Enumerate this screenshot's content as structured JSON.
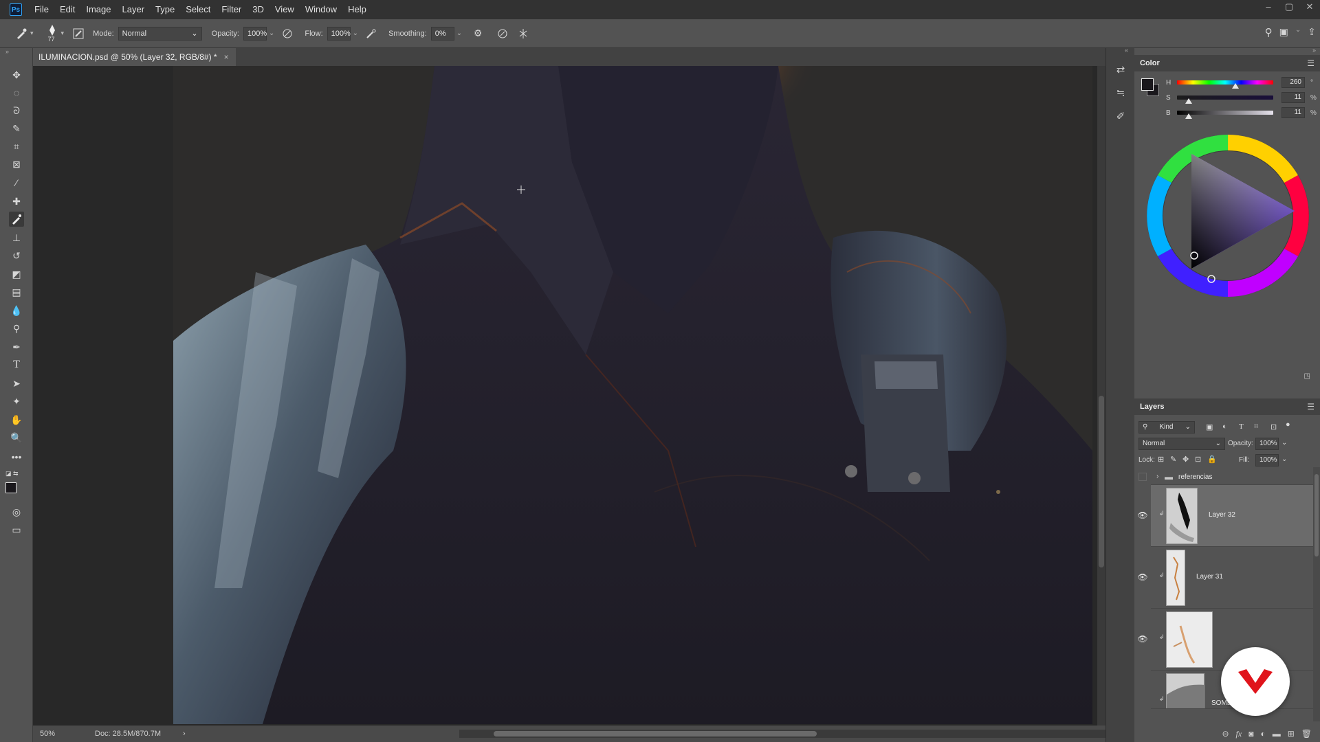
{
  "app": {
    "logo": "Ps"
  },
  "menu": [
    "File",
    "Edit",
    "Image",
    "Layer",
    "Type",
    "Select",
    "Filter",
    "3D",
    "View",
    "Window",
    "Help"
  ],
  "window_controls": [
    "minimize-icon",
    "maximize-icon",
    "close-icon"
  ],
  "options": {
    "brush_size": "77",
    "mode_label": "Mode:",
    "mode_value": "Normal",
    "opacity_label": "Opacity:",
    "opacity_value": "100%",
    "flow_label": "Flow:",
    "flow_value": "100%",
    "smoothing_label": "Smoothing:",
    "smoothing_value": "0%"
  },
  "document": {
    "tab_title": "ILUMINACION.psd @ 50% (Layer 32, RGB/8#) *",
    "close": "×"
  },
  "status": {
    "zoom": "50%",
    "doc_size": "Doc: 28.5M/870.7M",
    "arrow": "›"
  },
  "color_panel": {
    "title": "Color",
    "h_label": "H",
    "h_value": "260",
    "h_unit": "°",
    "s_label": "S",
    "s_value": "11",
    "s_unit": "%",
    "b_label": "B",
    "b_value": "11",
    "b_unit": "%",
    "foreground": "#1a181c",
    "background": "#ffffff"
  },
  "layers_panel": {
    "title": "Layers",
    "filter_label": "Kind",
    "blend_mode": "Normal",
    "opacity_label": "Opacity:",
    "opacity_value": "100%",
    "lock_label": "Lock:",
    "fill_label": "Fill:",
    "fill_value": "100%",
    "group_name": "referencias",
    "layers": [
      {
        "name": "Layer 32",
        "visible": true,
        "selected": true
      },
      {
        "name": "Layer 31",
        "visible": true,
        "selected": false
      },
      {
        "name": "",
        "visible": true,
        "selected": false
      },
      {
        "name": "SOMBRA",
        "visible": true,
        "selected": false
      }
    ],
    "footer_icons": [
      "link-icon",
      "fx-icon",
      "mask-icon",
      "adjustment-icon",
      "folder-icon",
      "new-layer-icon",
      "trash-icon"
    ]
  },
  "tools": [
    "move-icon",
    "marquee-icon",
    "lasso-icon",
    "quick-select-icon",
    "crop-icon",
    "frame-icon",
    "eyedropper-icon",
    "healing-icon",
    "brush-icon",
    "stamp-icon",
    "history-brush-icon",
    "eraser-icon",
    "gradient-icon",
    "blur-icon",
    "dodge-icon",
    "pen-icon",
    "type-icon",
    "path-select-icon",
    "shape-icon",
    "hand-icon",
    "zoom-icon",
    "more-tools-icon"
  ]
}
